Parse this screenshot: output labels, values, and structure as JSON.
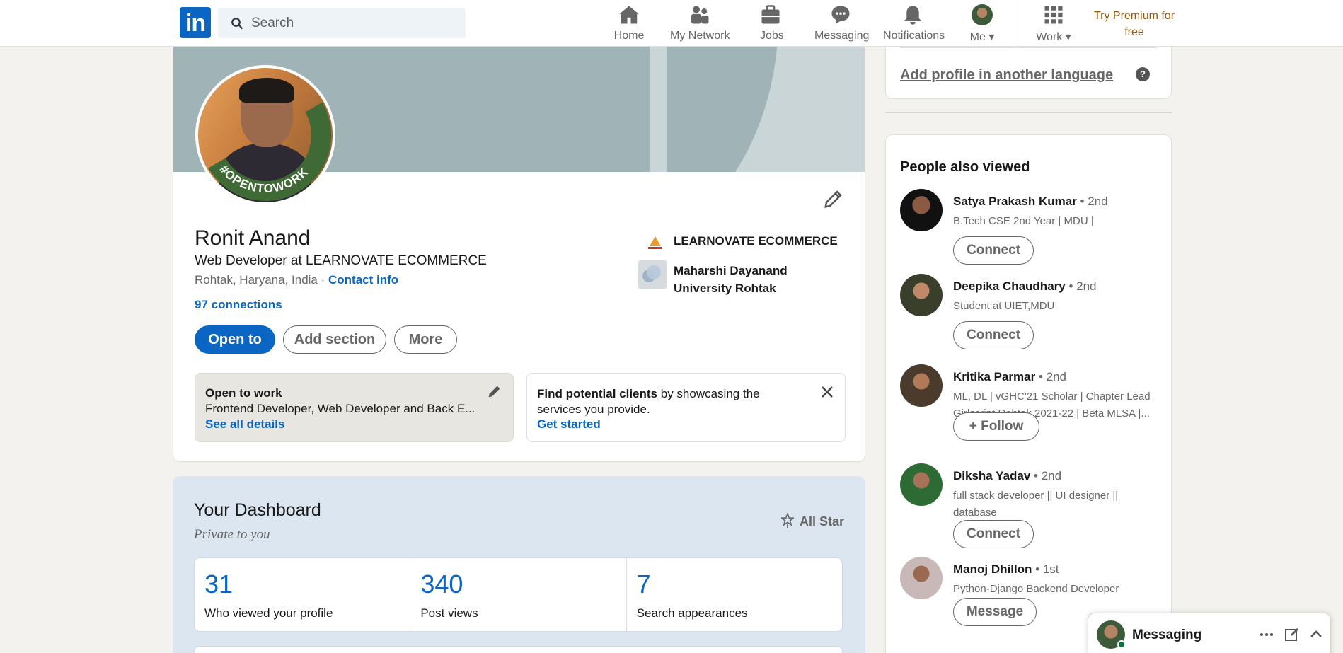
{
  "nav": {
    "search_placeholder": "Search",
    "items": [
      {
        "label": "Home",
        "icon": "home-icon"
      },
      {
        "label": "My Network",
        "icon": "network-icon"
      },
      {
        "label": "Jobs",
        "icon": "jobs-icon"
      },
      {
        "label": "Messaging",
        "icon": "messaging-icon"
      },
      {
        "label": "Notifications",
        "icon": "bell-icon"
      },
      {
        "label": "Me",
        "icon": "avatar"
      },
      {
        "label": "Work",
        "icon": "grid-icon"
      }
    ],
    "premium": "Try Premium for free"
  },
  "profile": {
    "name": "Ronit Anand",
    "headline": "Web Developer at LEARNOVATE ECOMMERCE",
    "location": "Rohtak, Haryana, India",
    "location_sep": " · ",
    "contact_info": "Contact info",
    "connections": "97 connections",
    "badge_text": "#OPENTOWORK",
    "buttons": {
      "open_to": "Open to",
      "add_section": "Add section",
      "more": "More"
    },
    "orgs": [
      {
        "name": "LEARNOVATE ECOMMERCE"
      },
      {
        "name": "Maharshi Dayanand University Rohtak"
      }
    ],
    "open_to_work": {
      "title": "Open to work",
      "roles": "Frontend Developer, Web Developer and Back E...",
      "link": "See all details"
    },
    "clients": {
      "bold": "Find potential clients",
      "rest": " by showcasing the services you provide.",
      "link": "Get started"
    }
  },
  "dashboard": {
    "title": "Your Dashboard",
    "subtitle": "Private to you",
    "badge": "All Star",
    "stats": [
      {
        "value": "31",
        "label": "Who viewed your profile"
      },
      {
        "value": "340",
        "label": "Post views"
      },
      {
        "value": "7",
        "label": "Search appearances"
      }
    ]
  },
  "rail": {
    "add_language": "Add profile in another language",
    "help": "?",
    "people_title": "People also viewed",
    "people": [
      {
        "name": "Satya Prakash Kumar",
        "degree": " • 2nd",
        "headline": "B.Tech CSE 2nd Year | MDU |",
        "action": "Connect"
      },
      {
        "name": "Deepika Chaudhary",
        "degree": " • 2nd",
        "headline": "Student at UIET,MDU",
        "action": "Connect"
      },
      {
        "name": "Kritika Parmar",
        "degree": " • 2nd",
        "headline": "ML, DL | vGHC'21 Scholar | Chapter Lead Girlscript Rohtak 2021-22 | Beta MLSA |...",
        "action": "Follow"
      },
      {
        "name": "Diksha Yadav",
        "degree": " • 2nd",
        "headline": "full stack developer || UI designer || database",
        "action": "Connect"
      },
      {
        "name": "Manoj Dhillon",
        "degree": " • 1st",
        "headline": "Python-Django Backend Developer",
        "action": "Message"
      }
    ]
  },
  "messaging": {
    "label": "Messaging"
  },
  "colors": {
    "brand": "#0a66c2",
    "premium": "#915907",
    "background": "#f3f2ef"
  }
}
